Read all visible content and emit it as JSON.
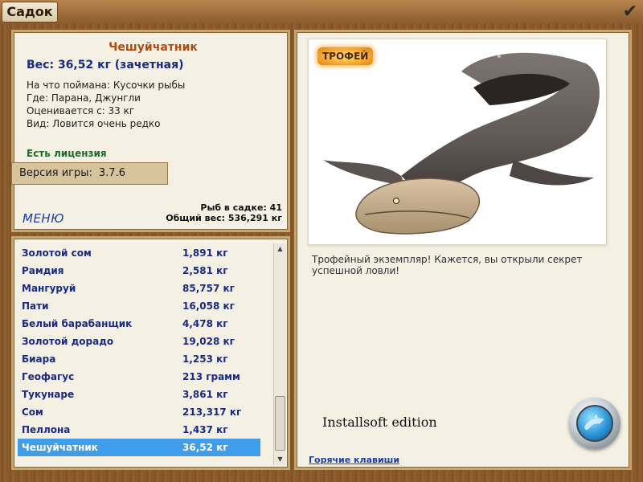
{
  "window": {
    "title": "Садок",
    "confirm_icon": "checkmark-icon"
  },
  "info": {
    "fish_name": "Чешуйчатник",
    "weight_line": "Вес: 36,52 кг (зачетная)",
    "caught_on": "На что поймана: Кусочки рыбы",
    "location": "Где: Парана, Джунгли",
    "rated_from": "Оценивается с: 33 кг",
    "rarity": "Вид: Ловится очень редко",
    "license": "Есть лицензия",
    "version_label": "Версия игры:",
    "version_value": "3.7.6",
    "menu": "МЕНЮ",
    "fish_count": "Рыб в садке: 41",
    "total_weight": "Общий вес: 536,291 кг"
  },
  "fish_list": [
    {
      "name": "Золотой сом",
      "weight": "1,891 кг"
    },
    {
      "name": "Рамдия",
      "weight": "2,581 кг"
    },
    {
      "name": "Мангуруй",
      "weight": "85,757 кг"
    },
    {
      "name": "Пати",
      "weight": "16,058 кг"
    },
    {
      "name": "Белый барабанщик",
      "weight": "4,478 кг"
    },
    {
      "name": "Золотой дорадо",
      "weight": "19,028 кг"
    },
    {
      "name": "Биара",
      "weight": "1,253 кг"
    },
    {
      "name": "Геофагус",
      "weight": "213 грамм"
    },
    {
      "name": "Тукунаре",
      "weight": "3,861 кг"
    },
    {
      "name": "Сом",
      "weight": "213,317 кг"
    },
    {
      "name": "Пеллона",
      "weight": "1,437 кг"
    },
    {
      "name": "Чешуйчатник",
      "weight": "36,52 кг"
    }
  ],
  "selected_index": 11,
  "photo": {
    "badge": "ТРОФЕЙ",
    "description": "Трофейный экземпляр! Кажется, вы открыли секрет успешной ловли!",
    "edition": "Installsoft edition",
    "hotkeys": "Горячие клавиши",
    "porthole_icon": "dolphin-porthole-icon"
  },
  "colors": {
    "accent_title": "#b04a10",
    "list_text": "#1b2a80",
    "selection": "#3f9de9",
    "license": "#1f6b2a"
  }
}
